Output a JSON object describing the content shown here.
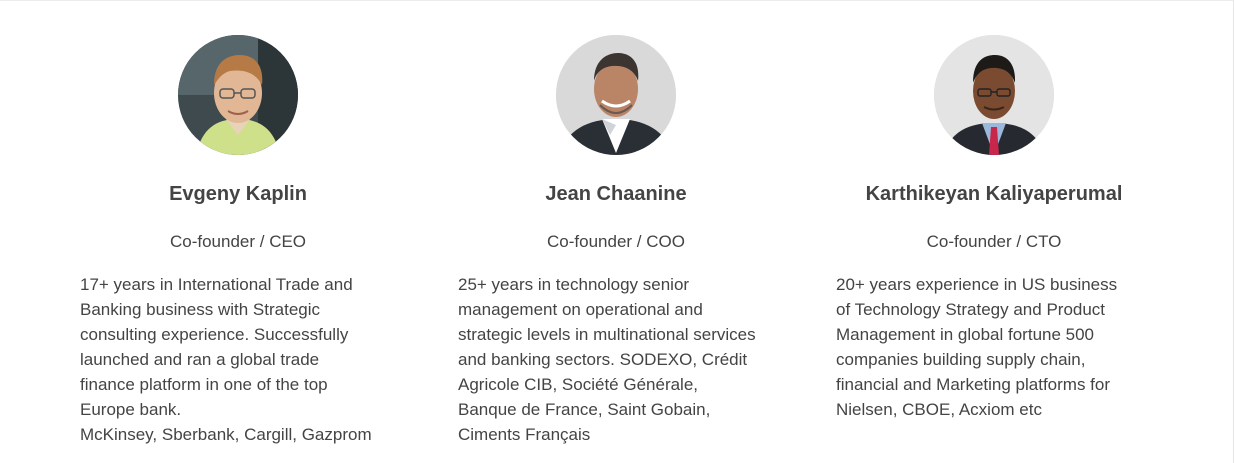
{
  "team": [
    {
      "name": "Evgeny Kaplin",
      "role": "Co-founder / CEO",
      "photo_icon": "person-photo-icon",
      "bio_lines": [
        "17+ years in International Trade and",
        "Banking business with Strategic",
        "consulting experience. Successfully",
        "launched and ran a global trade",
        "finance platform in one of the top",
        "Europe bank.",
        "McKinsey, Sberbank, Cargill, Gazprom"
      ]
    },
    {
      "name": "Jean Chaanine",
      "role": "Co-founder / COO",
      "photo_icon": "person-photo-icon",
      "bio_lines": [
        "25+ years in technology senior",
        "management on operational and",
        "strategic levels in multinational services",
        "and banking sectors. SODEXO, Crédit",
        "Agricole CIB, Société Générale,",
        "Banque de France, Saint Gobain,",
        "Ciments Français"
      ]
    },
    {
      "name": "Karthikeyan Kaliyaperumal",
      "role": "Co-founder / CTO",
      "photo_icon": "person-photo-icon",
      "bio_lines": [
        "20+ years experience in US business",
        "of Technology Strategy and Product",
        "Management in global fortune 500",
        "companies building supply chain,",
        "financial and Marketing platforms for",
        "Nielsen, CBOE, Acxiom etc"
      ]
    }
  ]
}
